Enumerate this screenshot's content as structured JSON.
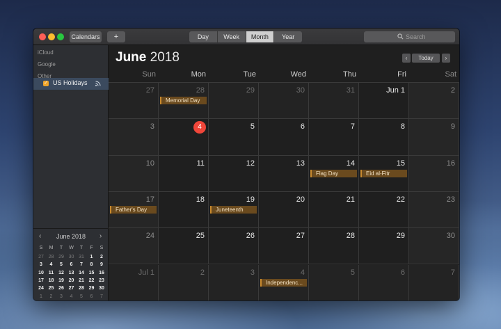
{
  "toolbar": {
    "calendars_label": "Calendars",
    "add_label": "+",
    "views": [
      "Day",
      "Week",
      "Month",
      "Year"
    ],
    "active_view": "Month",
    "search_placeholder": "Search"
  },
  "sidebar": {
    "sections": [
      "iCloud",
      "Google",
      "Other"
    ],
    "items": [
      {
        "label": "US Holidays",
        "checked": true,
        "color": "#f0a52a",
        "icon": "broadcast-icon"
      }
    ]
  },
  "mini_calendar": {
    "title": "June 2018",
    "prev_label": "‹",
    "next_label": "›",
    "weekdays": [
      "S",
      "M",
      "T",
      "W",
      "T",
      "F",
      "S"
    ],
    "weeks": [
      [
        "27",
        "28",
        "29",
        "30",
        "31",
        "1",
        "2"
      ],
      [
        "3",
        "4",
        "5",
        "6",
        "7",
        "8",
        "9"
      ],
      [
        "10",
        "11",
        "12",
        "13",
        "14",
        "15",
        "16"
      ],
      [
        "17",
        "18",
        "19",
        "20",
        "21",
        "22",
        "23"
      ],
      [
        "24",
        "25",
        "26",
        "27",
        "28",
        "29",
        "30"
      ],
      [
        "1",
        "2",
        "3",
        "4",
        "5",
        "6",
        "7"
      ]
    ]
  },
  "header": {
    "month": "June",
    "year": "2018",
    "prev_label": "‹",
    "today_label": "Today",
    "next_label": "›"
  },
  "weekdays": [
    "Sun",
    "Mon",
    "Tue",
    "Wed",
    "Thu",
    "Fri",
    "Sat"
  ],
  "weeks": [
    [
      {
        "d": "27",
        "outside": true
      },
      {
        "d": "28",
        "outside": true,
        "event": "Memorial Day"
      },
      {
        "d": "29",
        "outside": true
      },
      {
        "d": "30",
        "outside": true
      },
      {
        "d": "31",
        "outside": true
      },
      {
        "d": "Jun 1"
      },
      {
        "d": "2"
      }
    ],
    [
      {
        "d": "3"
      },
      {
        "d": "4",
        "today": true
      },
      {
        "d": "5"
      },
      {
        "d": "6"
      },
      {
        "d": "7"
      },
      {
        "d": "8"
      },
      {
        "d": "9"
      }
    ],
    [
      {
        "d": "10"
      },
      {
        "d": "11"
      },
      {
        "d": "12"
      },
      {
        "d": "13"
      },
      {
        "d": "14",
        "event": "Flag Day"
      },
      {
        "d": "15",
        "event": "Eid al-Fitr"
      },
      {
        "d": "16"
      }
    ],
    [
      {
        "d": "17",
        "event": "Father's Day"
      },
      {
        "d": "18"
      },
      {
        "d": "19",
        "event": "Juneteenth"
      },
      {
        "d": "20"
      },
      {
        "d": "21"
      },
      {
        "d": "22"
      },
      {
        "d": "23"
      }
    ],
    [
      {
        "d": "24"
      },
      {
        "d": "25"
      },
      {
        "d": "26"
      },
      {
        "d": "27"
      },
      {
        "d": "28"
      },
      {
        "d": "29"
      },
      {
        "d": "30"
      }
    ],
    [
      {
        "d": "Jul 1",
        "outside": true
      },
      {
        "d": "2",
        "outside": true
      },
      {
        "d": "3",
        "outside": true
      },
      {
        "d": "4",
        "outside": true,
        "event": "Independenc..."
      },
      {
        "d": "5",
        "outside": true
      },
      {
        "d": "6",
        "outside": true
      },
      {
        "d": "7",
        "outside": true
      }
    ]
  ],
  "colors": {
    "accent_today": "#f0463a",
    "event_bg": "#6a4a1e",
    "event_border": "#c98a2e"
  }
}
